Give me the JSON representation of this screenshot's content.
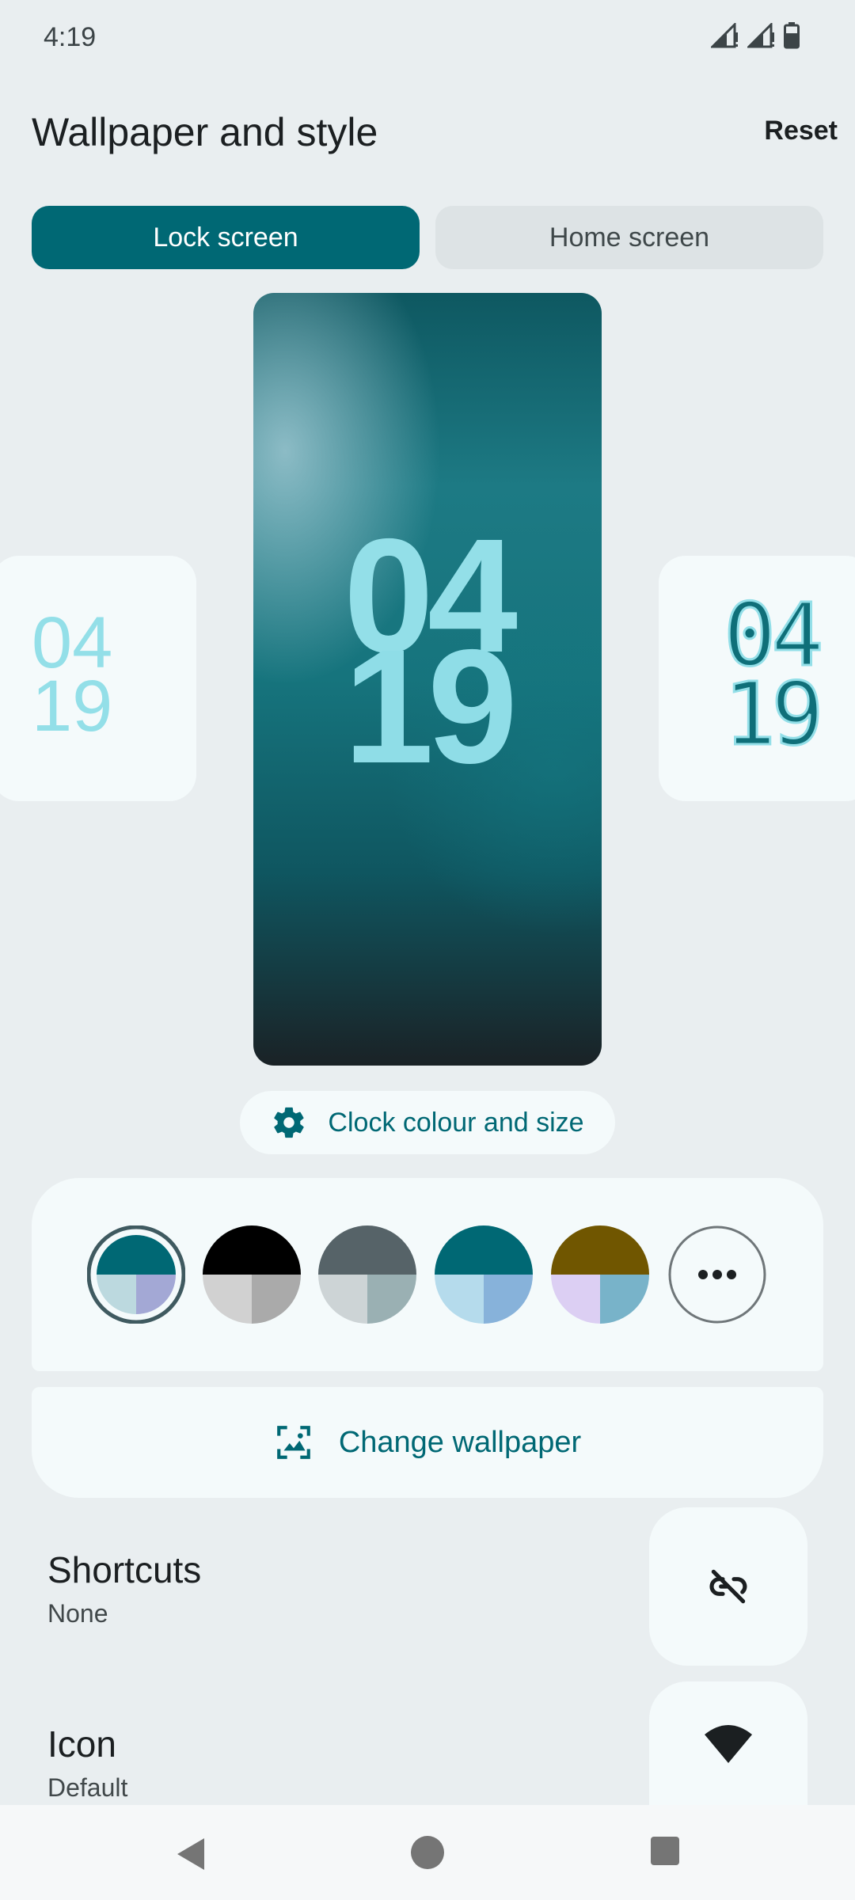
{
  "status_bar": {
    "time": "4:19"
  },
  "header": {
    "title": "Wallpaper and style",
    "reset_label": "Reset"
  },
  "tabs": [
    {
      "label": "Lock screen",
      "selected": true
    },
    {
      "label": "Home screen",
      "selected": false
    }
  ],
  "previews": {
    "left_clock": [
      "04",
      "19"
    ],
    "main_clock": [
      "04",
      "19"
    ],
    "right_clock": [
      "04",
      "19"
    ]
  },
  "clock_button_label": "Clock colour and size",
  "color_palettes": [
    {
      "top": "#006874",
      "bottom_left": "#bcd9df",
      "bottom_right": "#a3a8d5",
      "selected": true
    },
    {
      "top": "#000000",
      "bottom_left": "#d1d1d1",
      "bottom_right": "#aaaaaa",
      "selected": false
    },
    {
      "top": "#566368",
      "bottom_left": "#cdd4d6",
      "bottom_right": "#9ab0b3",
      "selected": false
    },
    {
      "top": "#006874",
      "bottom_left": "#b5dbec",
      "bottom_right": "#87b2da",
      "selected": false
    },
    {
      "top": "#705600",
      "bottom_left": "#dccff3",
      "bottom_right": "#78b3c9",
      "selected": false
    }
  ],
  "more_colors_icon": "more-horiz-icon",
  "change_wallpaper_label": "Change wallpaper",
  "settings": {
    "shortcuts": {
      "title": "Shortcuts",
      "value": "None",
      "icon": "link-off-icon"
    },
    "icon": {
      "title": "Icon",
      "value": "Default",
      "icon": "wifi-icon"
    }
  },
  "colors": {
    "accent": "#006874",
    "background": "#e9eef0",
    "surface": "#f4fafb"
  }
}
